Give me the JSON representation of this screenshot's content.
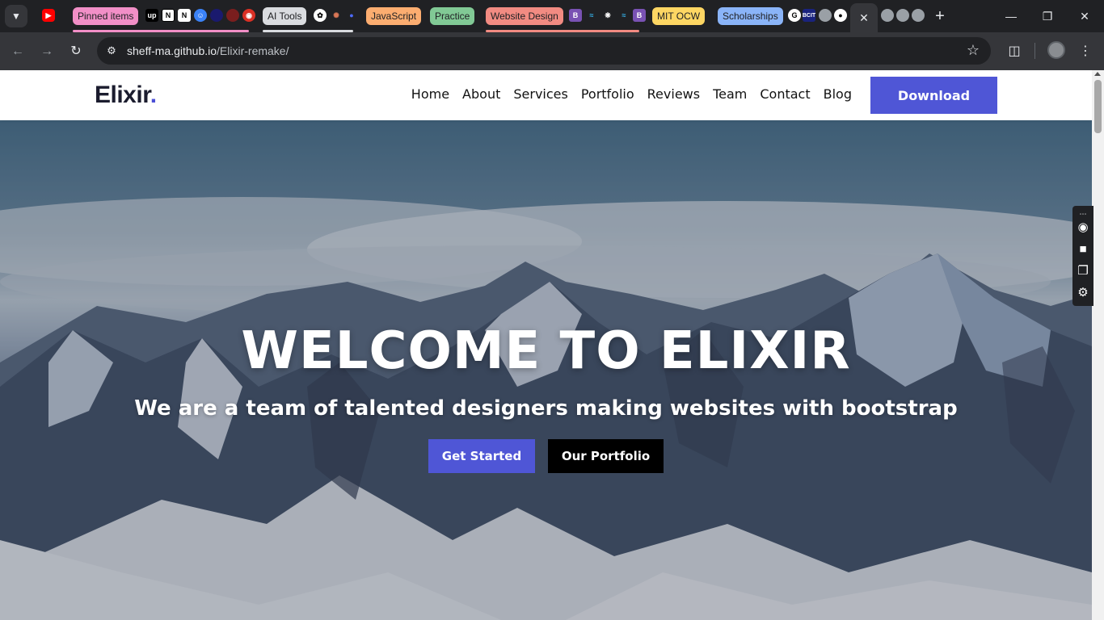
{
  "browser": {
    "tab_groups": [
      {
        "label": "Pinned items",
        "color": "#f28fc7"
      },
      {
        "label": "AI Tools",
        "color": "#dadce0"
      },
      {
        "label": "JavaScript",
        "color": "#fcad70"
      },
      {
        "label": "Practice",
        "color": "#81c995"
      },
      {
        "label": "Website Design",
        "color": "#f28b82"
      },
      {
        "label": "MIT OCW",
        "color": "#fdd663"
      },
      {
        "label": "Scholarships",
        "color": "#8ab4f8"
      }
    ],
    "url": {
      "host": "sheff-ma.github.io",
      "path": "/Elixir-remake/"
    }
  },
  "site": {
    "logo": "Elixir",
    "logo_dot": ".",
    "nav": [
      "Home",
      "About",
      "Services",
      "Portfolio",
      "Reviews",
      "Team",
      "Contact",
      "Blog"
    ],
    "download_label": "Download",
    "accent_color": "#4f56d6"
  },
  "hero": {
    "title": "WELCOME TO ELIXIR",
    "subtitle": "We are a team of talented designers making websites with bootstrap",
    "primary_button": "Get Started",
    "secondary_button": "Our Portfolio"
  }
}
